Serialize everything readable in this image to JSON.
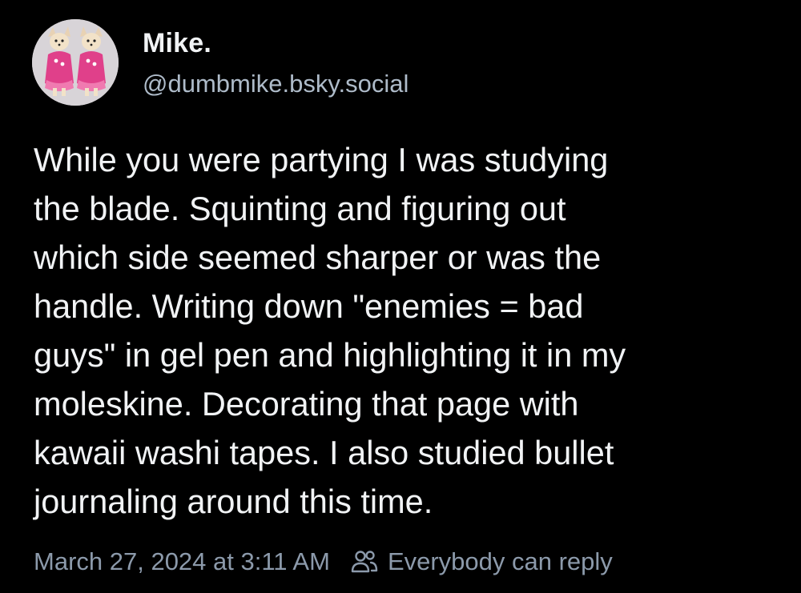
{
  "author": {
    "display_name": "Mike.",
    "handle": "@dumbmike.bsky.social",
    "avatar_icon": "avatar-chihuahuas-pink-outfits"
  },
  "post": {
    "lines": [
      "While you were partying I was studying",
      "the blade. Squinting and figuring out",
      "which side seemed sharper or was the",
      "handle. Writing down \"enemies = bad",
      "guys\" in gel pen and highlighting it in my",
      "moleskine. Decorating that page with",
      "kawaii washi tapes. I also studied bullet",
      "journaling around this time."
    ]
  },
  "meta": {
    "timestamp": "March 27, 2024 at 3:11 AM",
    "reply_setting": "Everybody can reply",
    "reply_icon": "people-icon"
  },
  "colors": {
    "background": "#000000",
    "text": "#f1f3f5",
    "handle": "#aebbc9",
    "meta": "#8c9aab",
    "avatar_accent": "#e0408a"
  }
}
